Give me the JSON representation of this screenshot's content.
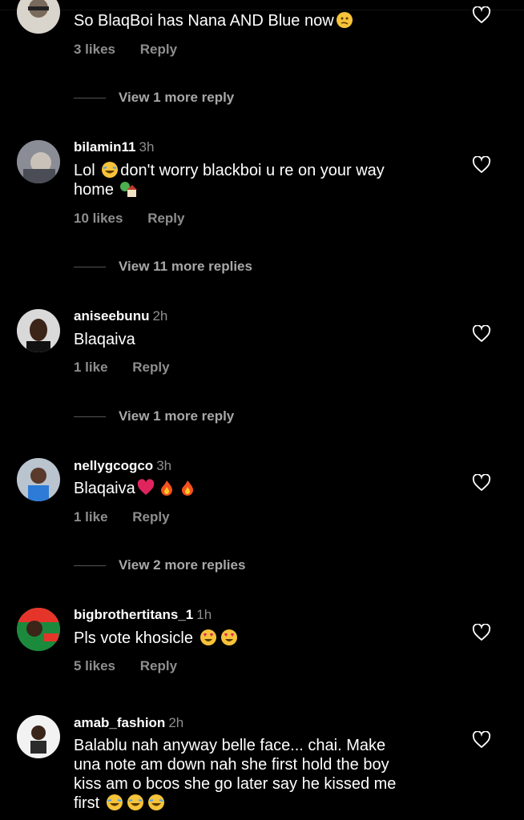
{
  "comments": [
    {
      "username": "",
      "time": "",
      "text": "So BlaqBoi has Nana AND Blue now",
      "likes": "3 likes",
      "reply": "Reply",
      "view_replies": "View 1 more reply"
    },
    {
      "username": "bilamin11",
      "time": "3h",
      "text_a": "Lol",
      "text_b": "don't worry blackboi u re on your way",
      "text_c": "home",
      "likes": "10 likes",
      "reply": "Reply",
      "view_replies": "View 11 more replies"
    },
    {
      "username": "aniseebunu",
      "time": "2h",
      "text": "Blaqaiva",
      "likes": "1 like",
      "reply": "Reply",
      "view_replies": "View 1 more reply"
    },
    {
      "username": "nellygcogco",
      "time": "3h",
      "text": "Blaqaiva",
      "likes": "1 like",
      "reply": "Reply",
      "view_replies": "View 2 more replies"
    },
    {
      "username": "bigbrothertitans_1",
      "time": "1h",
      "text": "Pls vote khosicle",
      "likes": "5 likes",
      "reply": "Reply"
    },
    {
      "username": "amab_fashion",
      "time": "2h",
      "line1": "Balablu nah anyway belle face... chai. Make",
      "line2": "una note am down nah she first hold the boy",
      "line3": "kiss am o bcos she go later say he kissed me",
      "line4": "first"
    }
  ],
  "icons": {
    "like": "heart-outline-icon",
    "emoji_thinking": "thinking-face-emoji",
    "emoji_laugh": "face-with-tears-of-joy-emoji",
    "emoji_house": "house-with-garden-emoji",
    "emoji_heart": "red-heart-emoji",
    "emoji_fire": "fire-emoji",
    "emoji_hearteyes": "heart-eyes-emoji"
  },
  "colors": {
    "background": "#000000",
    "primary_text": "#ffffff",
    "secondary_text": "#8e8e8e"
  }
}
